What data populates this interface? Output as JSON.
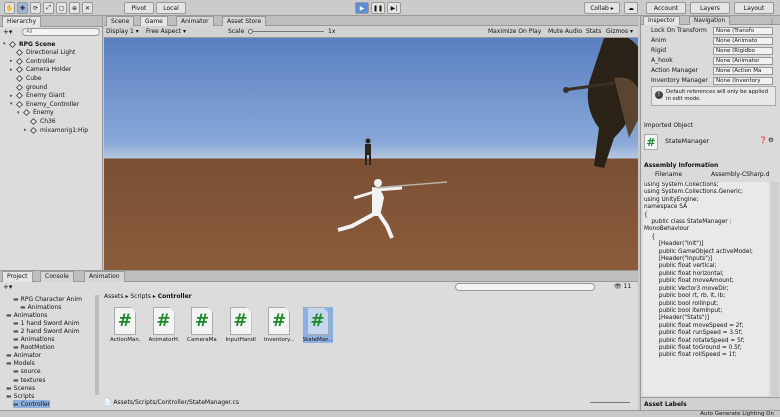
{
  "toolbar": {
    "pivot": "Pivot",
    "local": "Local",
    "collab": "Collab ▸",
    "account": "Account",
    "layers": "Layers",
    "layout": "Layout"
  },
  "hierarchy": {
    "tab": "Hierarchy",
    "search_placeholder": "All",
    "items": [
      {
        "label": "RPG Scene",
        "depth": 0
      },
      {
        "label": "Directional Light",
        "depth": 1
      },
      {
        "label": "Controller",
        "depth": 1
      },
      {
        "label": "Camera Holder",
        "depth": 1
      },
      {
        "label": "Cube",
        "depth": 1
      },
      {
        "label": "ground",
        "depth": 1
      },
      {
        "label": "Enemy Giant",
        "depth": 1
      },
      {
        "label": "Enemy_Controller",
        "depth": 1
      },
      {
        "label": "Enemy",
        "depth": 2
      },
      {
        "label": "Ch36",
        "depth": 3
      },
      {
        "label": "mixamorig1:Hip",
        "depth": 3
      }
    ]
  },
  "scene": {
    "tabs": [
      "Scene",
      "Game",
      "Animator",
      "Asset Store"
    ],
    "display": "Display 1",
    "aspect": "Free Aspect",
    "scale_label": "Scale",
    "scale_value": "1x",
    "options": [
      "Maximize On Play",
      "Mute Audio",
      "Stats",
      "Gizmos ▾"
    ]
  },
  "inspector": {
    "tabs": [
      "Inspector",
      "Navigation"
    ],
    "fields": [
      {
        "label": "Lock On Transform",
        "value": "None (Transfo"
      },
      {
        "label": "Anim",
        "value": "None (Animato"
      },
      {
        "label": "Rigid",
        "value": "None (Rigidbo"
      },
      {
        "label": "A_hook",
        "value": "None (Animator"
      },
      {
        "label": "Action Manager",
        "value": "None (Action Ma"
      },
      {
        "label": "Inventory Manager",
        "value": "None (Inventory"
      }
    ],
    "info": "Default references will only be applied in edit mode.",
    "imported_object": "Imported Object",
    "object_name": "StateManager",
    "assembly_info": "Assembly Information",
    "filename_label": "Filename",
    "filename_value": "Assembly-CSharp.d",
    "code": [
      "using System.Collections;",
      "using System.Collections.Generic;",
      "using UnityEngine;",
      "",
      "namespace SA",
      "{",
      "    public class StateManager :",
      "MonoBehaviour",
      "    {",
      "        [Header(\"Init\")]",
      "        public GameObject activeModel;",
      "",
      "        [Header(\"Inputs\")]",
      "        public float vertical;",
      "        public float horizontal;",
      "        public float moveAmount;",
      "        public Vector3 moveDir;",
      "        public bool rt, rb, lt, lb;",
      "        public bool rollInput;",
      "        public bool itemInput;",
      "",
      "        [Header(\"Stats\")]",
      "        public float moveSpeed = 2f;",
      "        public float runSpeed = 3.5f;",
      "        public float rotateSpeed = 5f;",
      "        public float toGround = 0.5f;",
      "        public float rollSpeed = 1f;"
    ],
    "asset_labels": "Asset Labels"
  },
  "project": {
    "tabs": [
      "Project",
      "Console",
      "Animation"
    ],
    "count": "11",
    "breadcrumb": [
      "Assets",
      "Scripts",
      "Controller"
    ],
    "tree": [
      {
        "label": "RPG Character Anim",
        "depth": 1
      },
      {
        "label": "Animations",
        "depth": 2
      },
      {
        "label": "Animations",
        "depth": 0
      },
      {
        "label": "1 hand Sword Anim",
        "depth": 1
      },
      {
        "label": "2 hand Sword Anim",
        "depth": 1
      },
      {
        "label": "Animations",
        "depth": 1
      },
      {
        "label": "RootMotion",
        "depth": 1
      },
      {
        "label": "Animator",
        "depth": 0
      },
      {
        "label": "Models",
        "depth": 0
      },
      {
        "label": "source",
        "depth": 1
      },
      {
        "label": "textures",
        "depth": 1
      },
      {
        "label": "Scenes",
        "depth": 0
      },
      {
        "label": "Scripts",
        "depth": 0
      },
      {
        "label": "Controller",
        "depth": 1
      }
    ],
    "assets": [
      "ActionMan...",
      "AnimatorH...",
      "CameraMa...",
      "InputHandl...",
      "Inventory...",
      "StateMan..."
    ],
    "path": "Assets/Scripts/Controller/StateManager.cs"
  },
  "status": {
    "right": "Auto Generate Lighting On"
  },
  "colors": {
    "sky_top": "#5a7fc0",
    "ground": "#7a4f33",
    "play_blue": "#5b8ed6",
    "selection": "#8cb0e0",
    "script_hash": "#1e8a2a"
  }
}
